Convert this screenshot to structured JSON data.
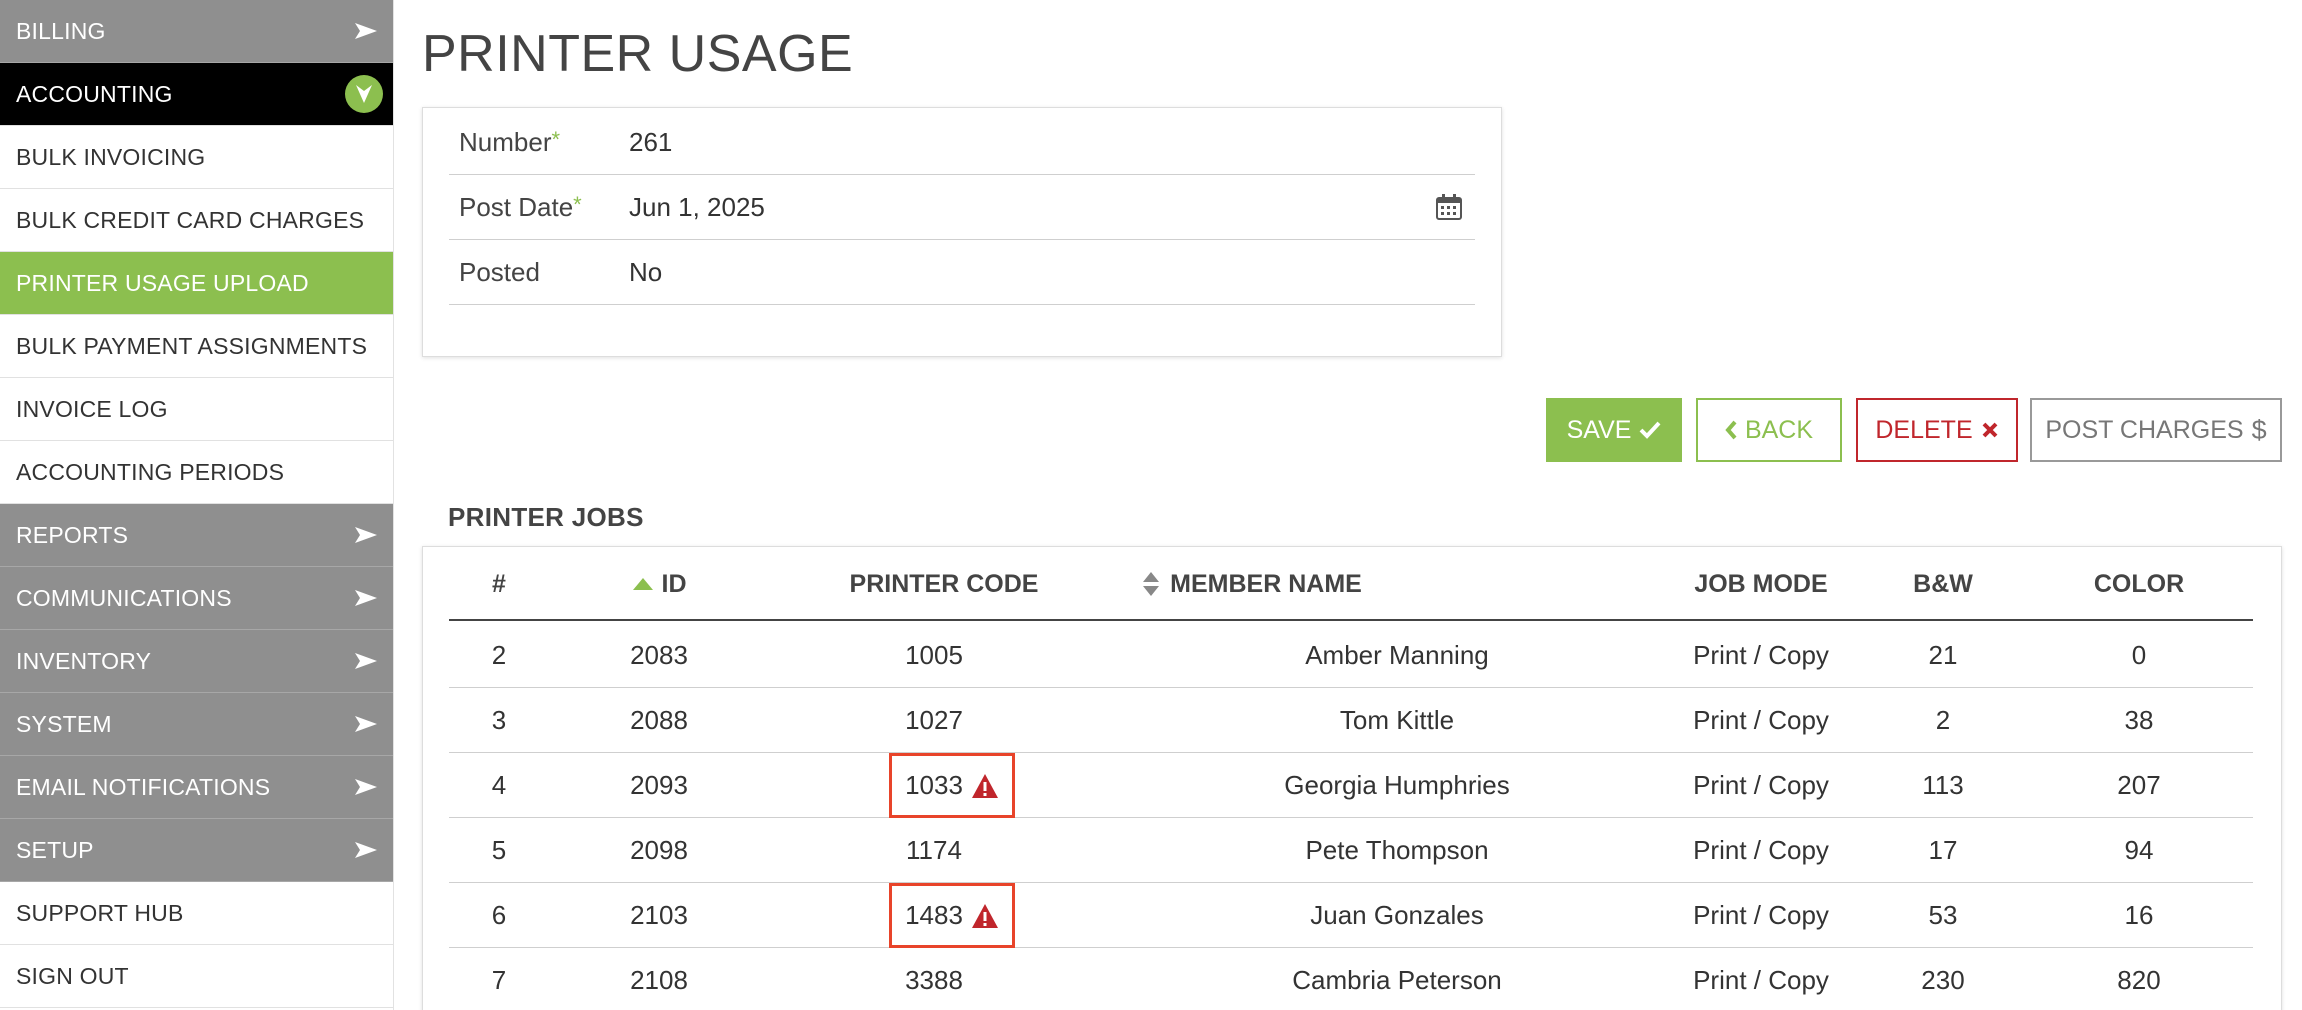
{
  "sidebar": {
    "items": [
      {
        "label": "BILLING",
        "style": "gray",
        "indicator": "arrow"
      },
      {
        "label": "ACCOUNTING",
        "style": "black",
        "indicator": "circle-chevron"
      },
      {
        "label": "BULK INVOICING",
        "style": "white",
        "indicator": "none"
      },
      {
        "label": "BULK CREDIT CARD CHARGES",
        "style": "white",
        "indicator": "none"
      },
      {
        "label": "PRINTER USAGE UPLOAD",
        "style": "green",
        "indicator": "none"
      },
      {
        "label": "BULK PAYMENT ASSIGNMENTS",
        "style": "white",
        "indicator": "none"
      },
      {
        "label": "INVOICE LOG",
        "style": "white",
        "indicator": "none"
      },
      {
        "label": "ACCOUNTING PERIODS",
        "style": "white",
        "indicator": "none"
      },
      {
        "label": "REPORTS",
        "style": "gray",
        "indicator": "arrow"
      },
      {
        "label": "COMMUNICATIONS",
        "style": "gray",
        "indicator": "arrow"
      },
      {
        "label": "INVENTORY",
        "style": "gray",
        "indicator": "arrow"
      },
      {
        "label": "SYSTEM",
        "style": "gray",
        "indicator": "arrow"
      },
      {
        "label": "EMAIL NOTIFICATIONS",
        "style": "gray",
        "indicator": "arrow"
      },
      {
        "label": "SETUP",
        "style": "gray",
        "indicator": "arrow"
      },
      {
        "label": "SUPPORT HUB",
        "style": "white",
        "indicator": "none"
      },
      {
        "label": "SIGN OUT",
        "style": "white",
        "indicator": "none"
      }
    ]
  },
  "page": {
    "title": "PRINTER USAGE"
  },
  "form": {
    "number_label": "Number",
    "number_value": "261",
    "post_date_label": "Post Date",
    "post_date_value": "Jun 1, 2025",
    "posted_label": "Posted",
    "posted_value": "No",
    "required_mark": "*"
  },
  "actions": {
    "save_label": "SAVE",
    "back_label": "BACK",
    "delete_label": "DELETE",
    "post_charges_label": "POST CHARGES"
  },
  "printer_jobs": {
    "section_title": "PRINTER JOBS",
    "columns": {
      "num": "#",
      "id": "ID",
      "printer_code": "PRINTER CODE",
      "member_name": "MEMBER NAME",
      "job_mode": "JOB MODE",
      "bw": "B&W",
      "color": "COLOR"
    },
    "rows": [
      {
        "num": "2",
        "id": "2083",
        "printer_code": "1005",
        "warning": false,
        "member_name": "Amber Manning",
        "job_mode": "Print / Copy",
        "bw": "21",
        "color": "0"
      },
      {
        "num": "3",
        "id": "2088",
        "printer_code": "1027",
        "warning": false,
        "member_name": "Tom Kittle",
        "job_mode": "Print / Copy",
        "bw": "2",
        "color": "38"
      },
      {
        "num": "4",
        "id": "2093",
        "printer_code": "1033",
        "warning": true,
        "member_name": "Georgia Humphries",
        "job_mode": "Print / Copy",
        "bw": "113",
        "color": "207"
      },
      {
        "num": "5",
        "id": "2098",
        "printer_code": "1174",
        "warning": false,
        "member_name": "Pete Thompson",
        "job_mode": "Print / Copy",
        "bw": "17",
        "color": "94"
      },
      {
        "num": "6",
        "id": "2103",
        "printer_code": "1483",
        "warning": true,
        "member_name": "Juan Gonzales",
        "job_mode": "Print / Copy",
        "bw": "53",
        "color": "16"
      },
      {
        "num": "7",
        "id": "2108",
        "printer_code": "3388",
        "warning": false,
        "member_name": "Cambria Peterson",
        "job_mode": "Print / Copy",
        "bw": "230",
        "color": "820"
      }
    ]
  },
  "colors": {
    "accent_green": "#8cbf4f",
    "danger_red": "#c0262c",
    "warning_box": "#e8442a",
    "sidebar_gray": "#8f8f8f"
  }
}
